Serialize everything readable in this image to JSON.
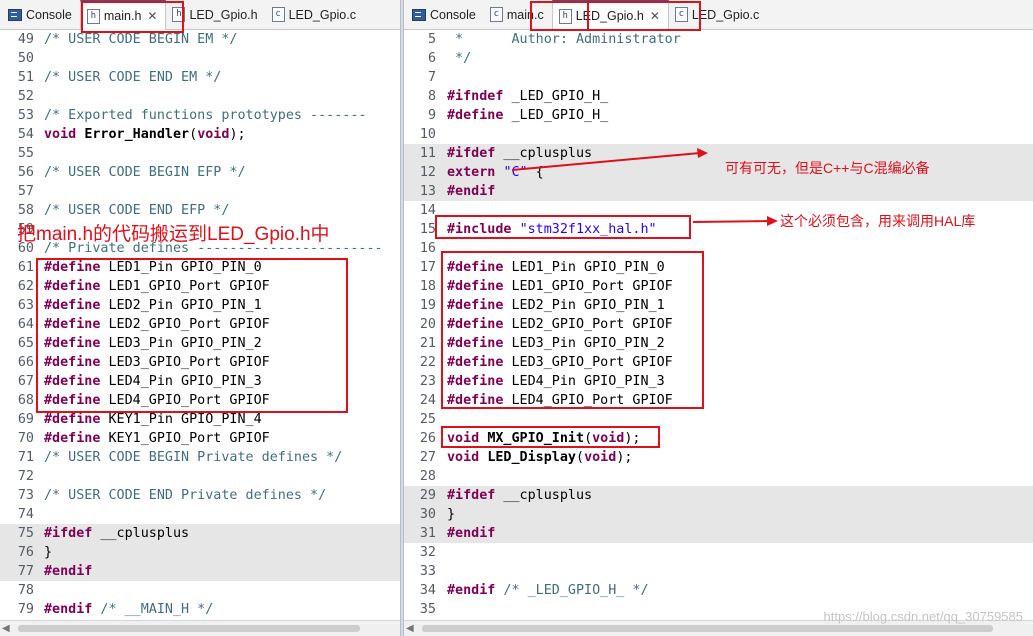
{
  "left": {
    "tabs": [
      {
        "label": "Console",
        "icon": "console-icon",
        "active": false
      },
      {
        "label": "main.h",
        "icon": "header-file-icon",
        "active": true,
        "close": "✕"
      },
      {
        "label": "LED_Gpio.h",
        "icon": "header-file-icon",
        "active": false
      },
      {
        "label": "LED_Gpio.c",
        "icon": "c-file-icon",
        "active": false
      }
    ],
    "lines": [
      {
        "n": "49",
        "t": "cmt",
        "s": "/* USER CODE BEGIN EM */"
      },
      {
        "n": "50",
        "t": "plain",
        "s": ""
      },
      {
        "n": "51",
        "t": "cmt",
        "s": "/* USER CODE END EM */"
      },
      {
        "n": "52",
        "t": "plain",
        "s": ""
      },
      {
        "n": "53",
        "t": "cmt",
        "s": "/* Exported functions prototypes -------"
      },
      {
        "n": "54",
        "t": "decl",
        "kw": "void",
        "fn": "Error_Handler",
        "kw2": "void"
      },
      {
        "n": "55",
        "t": "plain",
        "s": ""
      },
      {
        "n": "56",
        "t": "cmt",
        "s": "/* USER CODE BEGIN EFP */"
      },
      {
        "n": "57",
        "t": "plain",
        "s": ""
      },
      {
        "n": "58",
        "t": "cmt",
        "s": "/* USER CODE END EFP */"
      },
      {
        "n": "59",
        "t": "plain",
        "s": ""
      },
      {
        "n": "60",
        "t": "cmt",
        "s": "/* Private defines -----------------------"
      },
      {
        "n": "61",
        "t": "def",
        "kw": "#define",
        "s": " LED1_Pin GPIO_PIN_0"
      },
      {
        "n": "62",
        "t": "def",
        "kw": "#define",
        "s": " LED1_GPIO_Port GPIOF"
      },
      {
        "n": "63",
        "t": "def",
        "kw": "#define",
        "s": " LED2_Pin GPIO_PIN_1"
      },
      {
        "n": "64",
        "t": "def",
        "kw": "#define",
        "s": " LED2_GPIO_Port GPIOF"
      },
      {
        "n": "65",
        "t": "def",
        "kw": "#define",
        "s": " LED3_Pin GPIO_PIN_2"
      },
      {
        "n": "66",
        "t": "def",
        "kw": "#define",
        "s": " LED3_GPIO_Port GPIOF"
      },
      {
        "n": "67",
        "t": "def",
        "kw": "#define",
        "s": " LED4_Pin GPIO_PIN_3"
      },
      {
        "n": "68",
        "t": "def",
        "kw": "#define",
        "s": " LED4_GPIO_Port GPIOF"
      },
      {
        "n": "69",
        "t": "def",
        "kw": "#define",
        "s": " KEY1_Pin GPIO_PIN_4"
      },
      {
        "n": "70",
        "t": "def",
        "kw": "#define",
        "s": " KEY1_GPIO_Port GPIOF"
      },
      {
        "n": "71",
        "t": "cmt",
        "s": "/* USER CODE BEGIN Private defines */"
      },
      {
        "n": "72",
        "t": "plain",
        "s": ""
      },
      {
        "n": "73",
        "t": "cmt",
        "s": "/* USER CODE END Private defines */"
      },
      {
        "n": "74",
        "t": "plain",
        "s": ""
      },
      {
        "n": "75",
        "t": "def",
        "kw": "#ifdef",
        "s": " __cplusplus",
        "hl": true
      },
      {
        "n": "76",
        "t": "plain",
        "s": "}",
        "hl": true
      },
      {
        "n": "77",
        "t": "kwonly",
        "kw": "#endif",
        "hl": true
      },
      {
        "n": "78",
        "t": "plain",
        "s": ""
      },
      {
        "n": "79",
        "t": "endif",
        "kw": "#endif",
        "s": " /* __MAIN_H */"
      }
    ],
    "annotation": "把main.h的代码搬运到LED_Gpio.h中"
  },
  "right": {
    "tabs": [
      {
        "label": "Console",
        "icon": "console-icon",
        "active": false
      },
      {
        "label": "main.c",
        "icon": "c-file-icon",
        "active": false
      },
      {
        "label": "LED_Gpio.h",
        "icon": "header-file-icon",
        "active": true,
        "close": "✕"
      },
      {
        "label": "LED_Gpio.c",
        "icon": "c-file-icon",
        "active": false
      }
    ],
    "lines": [
      {
        "n": "5",
        "t": "cmt",
        "s": " *      Author: Administrator"
      },
      {
        "n": "6",
        "t": "cmt",
        "s": " */"
      },
      {
        "n": "7",
        "t": "plain",
        "s": ""
      },
      {
        "n": "8",
        "t": "def",
        "kw": "#ifndef",
        "s": " _LED_GPIO_H_"
      },
      {
        "n": "9",
        "t": "def",
        "kw": "#define",
        "s": " _LED_GPIO_H_"
      },
      {
        "n": "10",
        "t": "plain",
        "s": ""
      },
      {
        "n": "11",
        "t": "def",
        "kw": "#ifdef",
        "s": " __cplusplus",
        "hl": true
      },
      {
        "n": "12",
        "t": "extern",
        "kw": "extern",
        "str": "\"C\"",
        "s": " {",
        "hl": true
      },
      {
        "n": "13",
        "t": "kwonly",
        "kw": "#endif",
        "hl": true
      },
      {
        "n": "14",
        "t": "plain",
        "s": ""
      },
      {
        "n": "15",
        "t": "include",
        "kw": "#include",
        "str": "\"stm32f1xx_hal.h\""
      },
      {
        "n": "16",
        "t": "plain",
        "s": ""
      },
      {
        "n": "17",
        "t": "def",
        "kw": "#define",
        "s": " LED1_Pin GPIO_PIN_0"
      },
      {
        "n": "18",
        "t": "def",
        "kw": "#define",
        "s": " LED1_GPIO_Port GPIOF"
      },
      {
        "n": "19",
        "t": "def",
        "kw": "#define",
        "s": " LED2_Pin GPIO_PIN_1"
      },
      {
        "n": "20",
        "t": "def",
        "kw": "#define",
        "s": " LED2_GPIO_Port GPIOF"
      },
      {
        "n": "21",
        "t": "def",
        "kw": "#define",
        "s": " LED3_Pin GPIO_PIN_2"
      },
      {
        "n": "22",
        "t": "def",
        "kw": "#define",
        "s": " LED3_GPIO_Port GPIOF"
      },
      {
        "n": "23",
        "t": "def",
        "kw": "#define",
        "s": " LED4_Pin GPIO_PIN_3"
      },
      {
        "n": "24",
        "t": "def",
        "kw": "#define",
        "s": " LED4_GPIO_Port GPIOF"
      },
      {
        "n": "25",
        "t": "plain",
        "s": ""
      },
      {
        "n": "26",
        "t": "decl",
        "kw": "void",
        "fn": "MX_GPIO_Init",
        "kw2": "void"
      },
      {
        "n": "27",
        "t": "decl",
        "kw": "void",
        "fn": "LED_Display",
        "kw2": "void"
      },
      {
        "n": "28",
        "t": "plain",
        "s": ""
      },
      {
        "n": "29",
        "t": "def",
        "kw": "#ifdef",
        "s": " __cplusplus",
        "hl": true
      },
      {
        "n": "30",
        "t": "plain",
        "s": "}",
        "hl": true
      },
      {
        "n": "31",
        "t": "kwonly",
        "kw": "#endif",
        "hl": true
      },
      {
        "n": "32",
        "t": "plain",
        "s": ""
      },
      {
        "n": "33",
        "t": "plain",
        "s": ""
      },
      {
        "n": "34",
        "t": "endif",
        "kw": "#endif",
        "s": " /* _LED_GPIO_H_ */"
      },
      {
        "n": "35",
        "t": "plain",
        "s": ""
      }
    ],
    "annotations": {
      "cplusplus": "可有可无，但是C++与C混编必备",
      "include": "这个必须包含，用来调用HAL库"
    },
    "watermark": "https://blog.csdn.net/qq_30759585"
  },
  "colors": {
    "annotation_red": "#e0101a",
    "keyword": "#7f0055",
    "comment": "#3f6f7f",
    "string": "#2a00ff",
    "highlight_band": "#e6e6e6",
    "active_tab_accent": "#2c5d9a"
  }
}
